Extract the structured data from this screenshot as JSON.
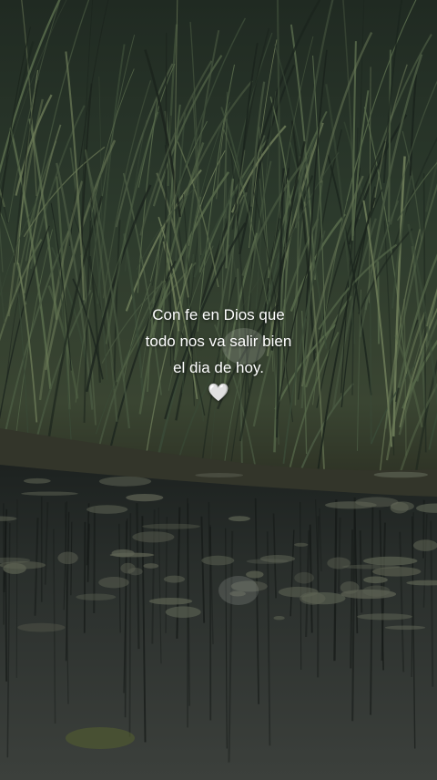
{
  "caption": {
    "lines": [
      "Con fe en Dios que",
      "todo nos va salir bien",
      "el dia de hoy."
    ],
    "emoji": "🤍"
  },
  "palette": {
    "grass_dark": "#1b241d",
    "grass_mid": "#3a4a37",
    "grass_light": "#6c7b58",
    "bank": "#3b3a2a",
    "water": "#2b302d",
    "lily_pad": "#5d6253"
  }
}
